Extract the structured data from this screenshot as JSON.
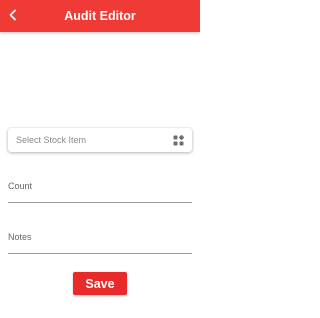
{
  "app_bar": {
    "title": "Audit Editor",
    "back_icon": "chevron-left-icon",
    "background_color": "#f03a36",
    "text_color": "#ffffff"
  },
  "form": {
    "stock_select": {
      "placeholder": "Select Stock Item",
      "icon": "scan-grid-icon"
    },
    "count_field": {
      "label": "Count",
      "value": ""
    },
    "notes_field": {
      "label": "Notes",
      "value": ""
    },
    "save_button": {
      "label": "Save",
      "color": "#e92a2a"
    }
  }
}
